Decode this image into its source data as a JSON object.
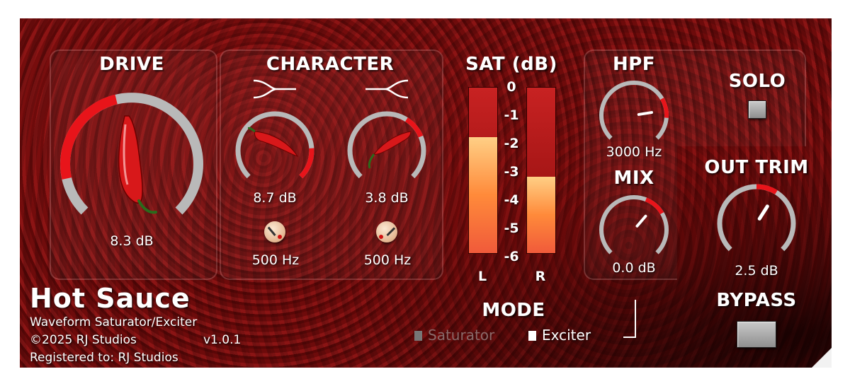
{
  "plugin": {
    "name": "Hot Sauce",
    "subtitle": "Waveform Saturator/Exciter",
    "copyright": "©2025 RJ Studios",
    "version": "v1.0.1",
    "registered": "Registered to: RJ Studios"
  },
  "drive": {
    "label": "DRIVE",
    "value": "8.3 dB",
    "level": 0.45
  },
  "character": {
    "label": "CHARACTER",
    "left": {
      "icon": "split-arrow-right-icon",
      "value": "8.7 dB",
      "level": 1.0,
      "freq": "500 Hz"
    },
    "right": {
      "icon": "split-arrow-left-icon",
      "value": "3.8 dB",
      "level": 0.75,
      "freq": "500 Hz"
    }
  },
  "sat": {
    "label": "SAT (dB)",
    "ticks": [
      "0",
      "-1",
      "-2",
      "-3",
      "-4",
      "-5",
      "-6"
    ],
    "left": {
      "label": "L",
      "level": 0.7
    },
    "right": {
      "label": "R",
      "level": 0.46
    }
  },
  "hpf": {
    "label": "HPF",
    "value": "3000 Hz",
    "level": 0.8
  },
  "mix": {
    "label": "MIX",
    "value": "0.0 dB",
    "level": 0.65
  },
  "solo": {
    "label": "SOLO"
  },
  "out_trim": {
    "label": "OUT TRIM",
    "value": "2.5 dB",
    "level": 0.62
  },
  "bypass": {
    "label": "BYPASS"
  },
  "mode": {
    "label": "MODE",
    "options": [
      {
        "label": "Saturator",
        "selected": false
      },
      {
        "label": "Exciter",
        "selected": true
      }
    ]
  },
  "colors": {
    "accent": "#e8141a",
    "arc": "#b9b9b9",
    "panel": "#720d0d"
  }
}
